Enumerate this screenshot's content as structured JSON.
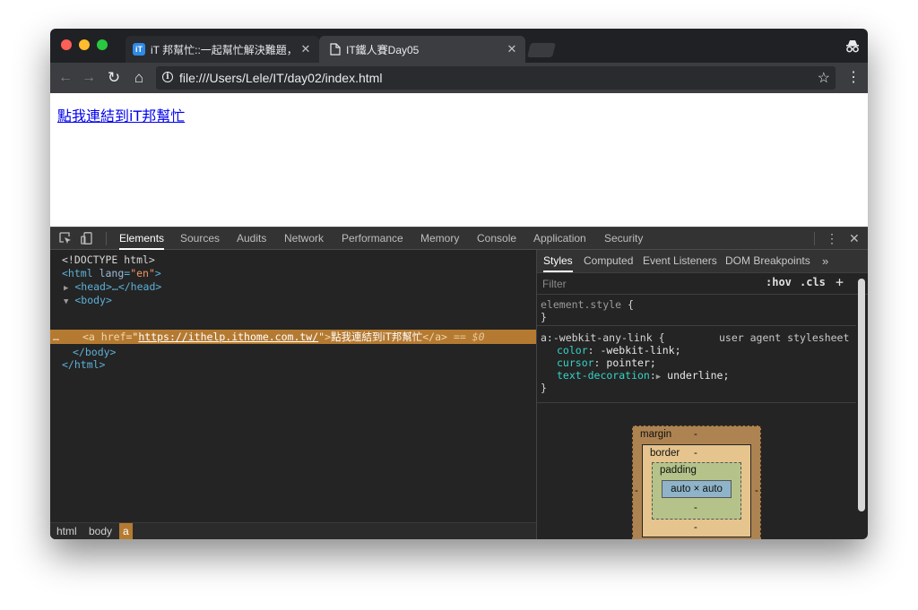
{
  "browser": {
    "tabs": [
      {
        "title": "iT 邦幫忙::一起幫忙解決難題，拯救 IT 人的一天",
        "favicon": "iT",
        "active": false
      },
      {
        "title": "IT鐵人賽Day05",
        "active": true
      }
    ],
    "tab_close": "✕",
    "nav": {
      "back": "←",
      "forward": "→",
      "reload": "↻",
      "home": "⌂"
    },
    "address": "file:///Users/Lele/IT/day02/index.html",
    "info_icon": "i",
    "star": "☆",
    "menu": "⋮"
  },
  "page": {
    "link_text": "點我連結到iT邦幫忙"
  },
  "devtools": {
    "tabs": [
      "Elements",
      "Sources",
      "Audits",
      "Network",
      "Performance",
      "Memory",
      "Console",
      "Application",
      "Security"
    ],
    "active_tab": "Elements",
    "more": "⋮",
    "close": "✕",
    "dom": {
      "doctype": "<!DOCTYPE html>",
      "html_open": "<html",
      "lang_attr": "lang",
      "lang_val": "\"en\"",
      "gt": ">",
      "head": "<head>…</head>",
      "body_open": "<body>",
      "sel_dots": "…",
      "a_open": "<a",
      "href_attr": "href=",
      "quote": "\"",
      "href_val": "https://ithelp.ithome.com.tw/",
      "a_text": "點我連結到iT邦幫忙",
      "a_close": "</a>",
      "eq_marker": "== $0",
      "body_close": "</body>",
      "html_close": "</html>",
      "tri_closed": "▶",
      "tri_open": "▼"
    },
    "breadcrumbs": [
      "html",
      "body",
      "a"
    ],
    "styles": {
      "tabs": [
        "Styles",
        "Computed",
        "Event Listeners",
        "DOM Breakpoints"
      ],
      "more": "»",
      "filter_placeholder": "Filter",
      "hov": ":hov",
      "cls": ".cls",
      "plus": "+",
      "element_style": "element.style",
      "open_brace": "{",
      "close_brace": "}",
      "ua_selector": "a:-webkit-any-link",
      "ua_source": "user agent stylesheet",
      "declarations": [
        {
          "prop": "color",
          "value": "-webkit-link;"
        },
        {
          "prop": "cursor",
          "value": "pointer;"
        },
        {
          "prop": "text-decoration",
          "value": "underline;"
        }
      ],
      "expand": "▶",
      "colon": ":"
    },
    "box_model": {
      "margin_label": "margin",
      "border_label": "border",
      "padding_label": "padding",
      "content": "auto × auto",
      "dash": "-"
    }
  }
}
